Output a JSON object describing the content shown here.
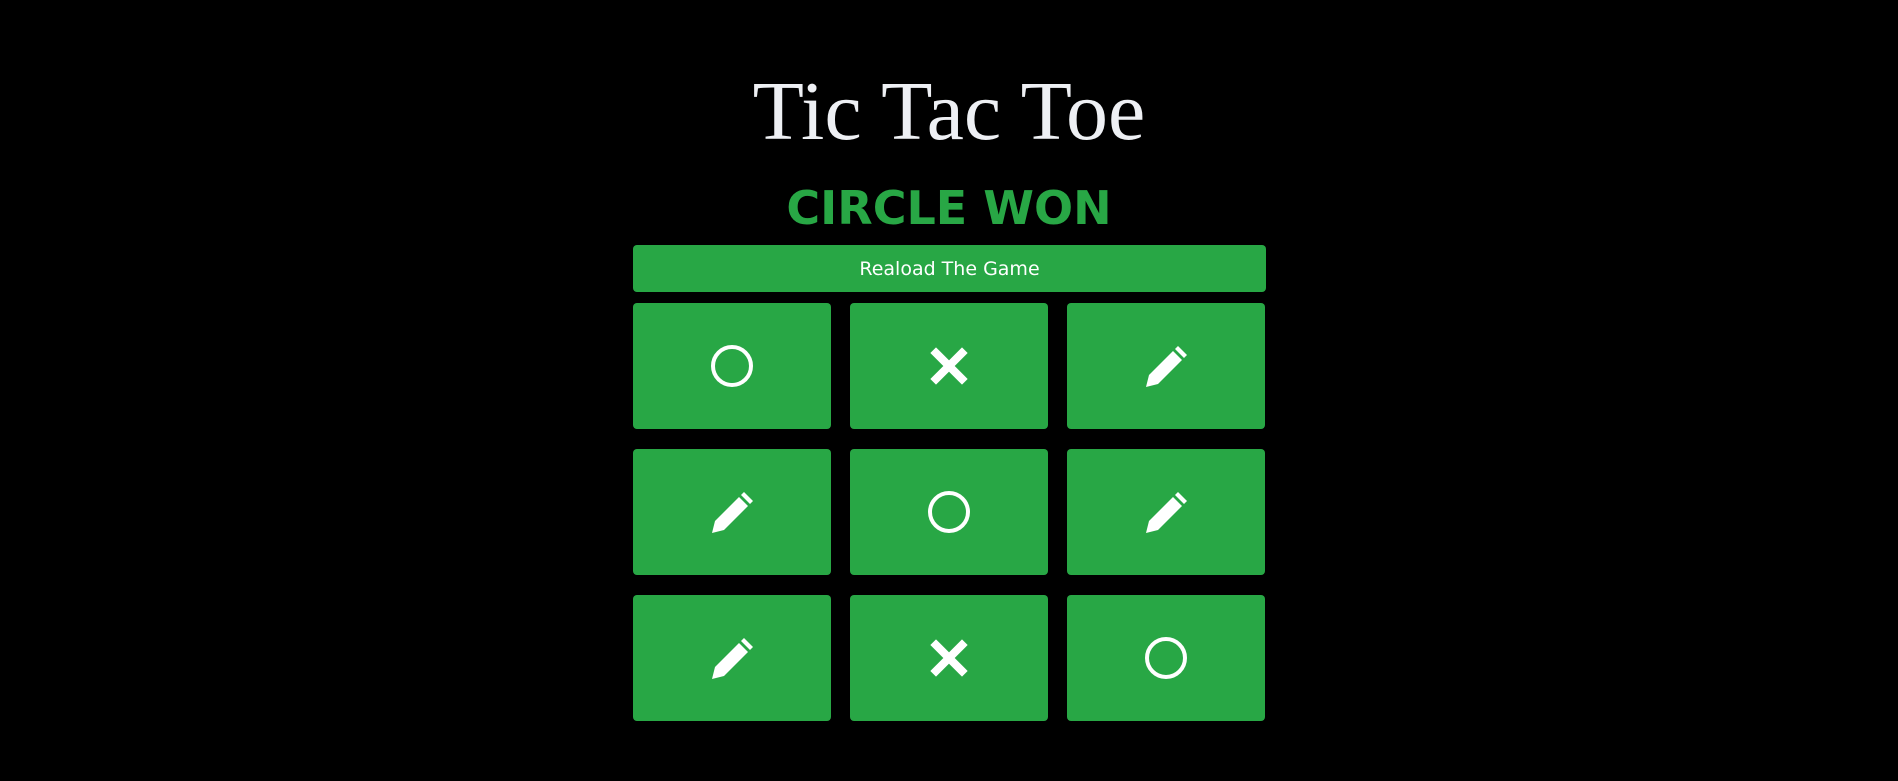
{
  "title": "Tic Tac Toe",
  "status": "CIRCLE WON",
  "reload_label": "Reaload The Game",
  "colors": {
    "background": "#000000",
    "accent": "#28a745",
    "title": "#eef0f4",
    "icon": "#ffffff"
  },
  "board": [
    [
      "circle",
      "cross",
      "pencil"
    ],
    [
      "pencil",
      "circle",
      "pencil"
    ],
    [
      "pencil",
      "cross",
      "circle"
    ]
  ]
}
